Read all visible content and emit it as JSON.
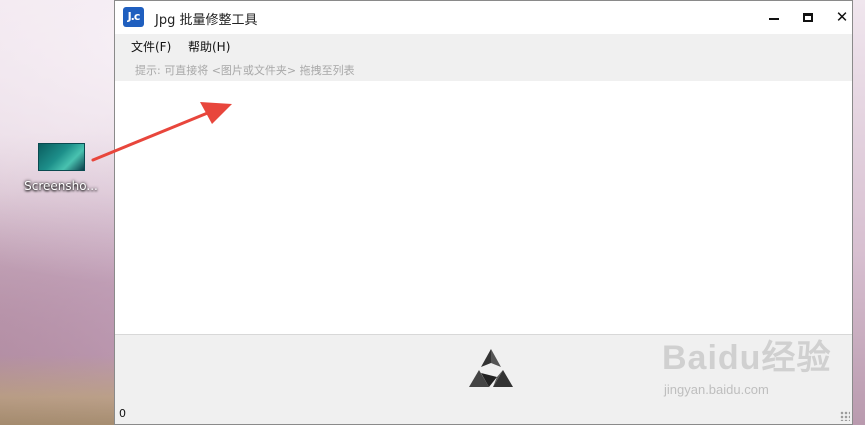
{
  "desktop": {
    "icon_label": "Screensho...",
    "annotation_color": "#e8463c"
  },
  "window": {
    "app_icon_text": "J.c",
    "title": "Jpg 批量修整工具",
    "controls": {
      "minimize": "minimize-icon",
      "maximize": "maximize-icon",
      "close": "✕"
    }
  },
  "menu": {
    "file": "文件(F)",
    "help": "帮助(H)"
  },
  "hint": "提示: 可直接将 <图片或文件夹> 拖拽至列表",
  "file_list": [],
  "status": {
    "count": "0"
  },
  "watermark": {
    "brand": "Baidu经验",
    "url": "jingyan.baidu.com"
  },
  "colors": {
    "accent": "#1f5fbf",
    "arrow": "#e8463c",
    "panel_bg": "#f0f0f0"
  }
}
